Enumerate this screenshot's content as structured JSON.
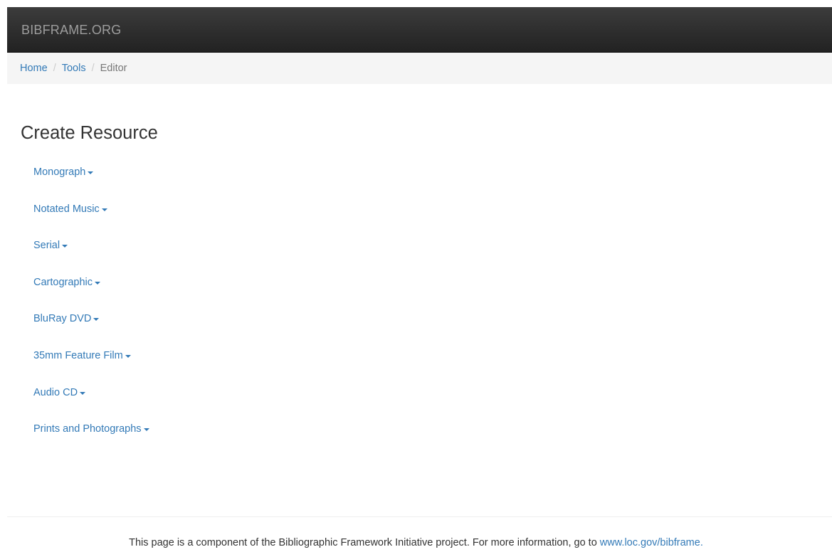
{
  "navbar": {
    "brand": "BIBFRAME.ORG"
  },
  "breadcrumb": {
    "items": [
      "Home",
      "Tools"
    ],
    "separator": "/",
    "active": "Editor"
  },
  "main": {
    "title": "Create Resource",
    "resources": [
      "Monograph",
      "Notated Music",
      "Serial",
      "Cartographic",
      "BluRay DVD",
      "35mm Feature Film",
      "Audio CD",
      "Prints and Photographs"
    ]
  },
  "footer": {
    "text": "This page is a component of the Bibliographic Framework Initiative project. For more information, go to",
    "link": "www.loc.gov/bibframe."
  },
  "colors": {
    "link": "#337ab7",
    "navbar": "#222222",
    "breadcrumb_bg": "#f5f5f5"
  }
}
